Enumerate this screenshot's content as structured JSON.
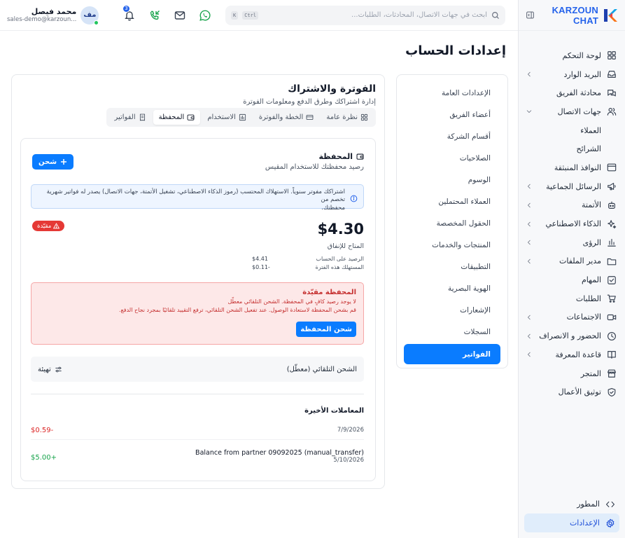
{
  "brand": {
    "name": "KARZOUN CHAT"
  },
  "sidebar": {
    "items": [
      {
        "label": "لوحة التحكم",
        "icon": "dashboard-icon",
        "chevron": false
      },
      {
        "label": "البريد الوارد",
        "icon": "inbox-icon",
        "chevron": true
      },
      {
        "label": "محادثة الفريق",
        "icon": "chat-icon",
        "chevron": false
      },
      {
        "label": "جهات الاتصال",
        "icon": "users-icon",
        "chevron": true,
        "expanded": true
      },
      {
        "label": "العملاء",
        "sub": true
      },
      {
        "label": "الشرائح",
        "sub": true
      },
      {
        "label": "النوافذ المنبثقة",
        "icon": "popup-icon",
        "chevron": false
      },
      {
        "label": "الرسائل الجماعية",
        "icon": "megaphone-icon",
        "chevron": true
      },
      {
        "label": "الأتمتة",
        "icon": "bot-icon",
        "chevron": true
      },
      {
        "label": "الذكاء الاصطناعي",
        "icon": "sparkles-icon",
        "chevron": true
      },
      {
        "label": "الرؤى",
        "icon": "bar-chart-icon",
        "chevron": true
      },
      {
        "label": "مدير الملفات",
        "icon": "folder-icon",
        "chevron": true
      },
      {
        "label": "المهام",
        "icon": "task-icon",
        "chevron": false
      },
      {
        "label": "الطلبات",
        "icon": "cart-icon",
        "chevron": false
      },
      {
        "label": "الاجتماعات",
        "icon": "video-icon",
        "chevron": true
      },
      {
        "label": "الحضور و الانصراف",
        "icon": "clock-icon",
        "chevron": true
      },
      {
        "label": "قاعدة المعرفة",
        "icon": "book-icon",
        "chevron": true
      },
      {
        "label": "المتجر",
        "icon": "store-icon",
        "chevron": false
      },
      {
        "label": "توثيق الأعمال",
        "icon": "shield-check-icon",
        "chevron": false
      }
    ],
    "bottom": [
      {
        "label": "المطور",
        "icon": "code-icon"
      },
      {
        "label": "الإعدادات",
        "icon": "gear-icon",
        "active": true
      }
    ]
  },
  "topbar": {
    "search_placeholder": "ابحث في جهات الاتصال، المحادثات، الطلبات...",
    "kbd_ctrl": "Ctrl",
    "kbd_k": "K",
    "notifications_count": "3",
    "user": {
      "initials": "مف",
      "name": "محمد فيصل",
      "email": "sales-demo@karzoun..."
    }
  },
  "page": {
    "title": "إعدادات الحساب"
  },
  "settings_nav": {
    "items": [
      "الإعدادات العامة",
      "أعضاء الفريق",
      "أقسام الشركة",
      "الصلاحيات",
      "الوسوم",
      "العملاء المحتملين",
      "الحقول المخصصة",
      "المنتجات والخدمات",
      "التطبيقات",
      "الهوية البصرية",
      "الإشعارات",
      "السجلات"
    ],
    "active": "الفواتير"
  },
  "billing": {
    "title": "الفوترة والاشتراك",
    "subtitle": "إدارة اشتراكك وطرق الدفع ومعلومات الفوترة",
    "tabs": [
      {
        "label": "نظرة عامة",
        "icon": "grid-icon"
      },
      {
        "label": "الخطة والفوترة",
        "icon": "credit-card-icon"
      },
      {
        "label": "الاستخدام",
        "icon": "usage-chart-icon"
      },
      {
        "label": "المحفظة",
        "icon": "wallet-icon",
        "active": true
      },
      {
        "label": "الفواتير",
        "icon": "receipt-icon"
      }
    ]
  },
  "wallet": {
    "title": "المحفظة",
    "subtitle": "رصيد محفظتك للاستخدام المقيس",
    "charge_button": "شحن",
    "info_line1": "اشتراكك مفوتر سنوياً. الاستهلاك المحتسب (رموز الذكاء الاصطناعي، تشغيل الأتمتة، جهات الاتصال) يصدر له فواتير شهرية تخصم من",
    "info_line2": "محفظتك.",
    "balance": "$4.30",
    "status_badge": "مقيّدة",
    "available_label": "المتاح للإنفاق",
    "account_balance_label": "الرصيد على الحساب",
    "account_balance_value": "$4.41",
    "consumed_label": "المستهلك هذه الفترة",
    "consumed_value": "$0.11-",
    "alert_title": "المحفظة مقيّدة",
    "alert_line1": "لا يوجد رصيد كافٍ في المحفظة. الشحن التلقائي معطّل",
    "alert_line2": "قم بشحن المحفظة لاستعادة الوصول. عند تفعيل الشحن التلقائي، ترفع التقييد تلقائيًا بمجرد نجاح الدفع.",
    "alert_button": "شحن المحفظة",
    "autocharge_label": "الشحن التلقائي (معطّل)",
    "setup_button": "تهيئة",
    "transactions_title": "المعاملات الأخيرة",
    "transactions": [
      {
        "description": "",
        "date": "7/9/2026",
        "amount": "$0.59-",
        "kind": "debit"
      },
      {
        "description": "Balance from partner 09092025 (manual_transfer)",
        "date": "5/10/2026",
        "amount": "$5.00+",
        "kind": "credit"
      }
    ]
  },
  "colors": {
    "primary": "#0a7cff",
    "danger": "#e53935",
    "success": "#16a34a",
    "active_nav_bg": "#e0edfb"
  }
}
